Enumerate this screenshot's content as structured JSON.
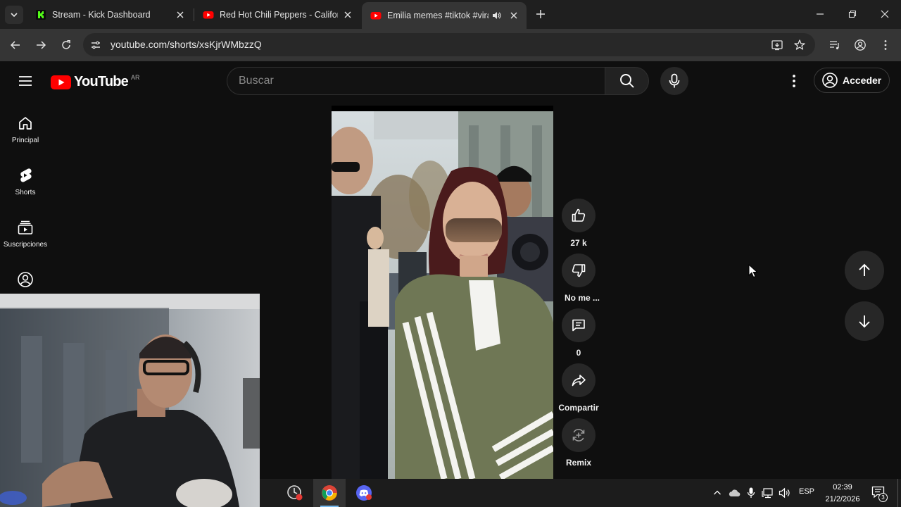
{
  "browser": {
    "tabs": [
      {
        "title": "Stream - Kick Dashboard",
        "favicon": "kick-icon",
        "active": false
      },
      {
        "title": "Red Hot Chili Peppers - Californ",
        "favicon": "youtube-icon",
        "active": false
      },
      {
        "title": "Emilia memes #tiktok #viral",
        "favicon": "youtube-icon",
        "active": true,
        "audio": true
      }
    ],
    "url": "youtube.com/shorts/xsKjrWMbzzQ"
  },
  "youtube": {
    "logo_text": "YouTube",
    "country_code": "AR",
    "search_placeholder": "Buscar",
    "signin_label": "Acceder",
    "sidebar": [
      {
        "label": "Principal",
        "icon": "home-icon"
      },
      {
        "label": "Shorts",
        "icon": "shorts-icon"
      },
      {
        "label": "Suscripciones",
        "icon": "subscriptions-icon"
      },
      {
        "label": "",
        "icon": "account-icon"
      }
    ],
    "actions": {
      "like_count": "27 k",
      "dislike_label": "No me ...",
      "comment_count": "0",
      "share_label": "Compartir",
      "remix_label": "Remix"
    }
  },
  "taskbar": {
    "language": "ESP",
    "time": "02:39",
    "date": "21/2/2026",
    "notification_count": "3"
  },
  "colors": {
    "youtube_red": "#ff0000",
    "kick_green": "#53fc18",
    "background": "#0f0f0f"
  }
}
